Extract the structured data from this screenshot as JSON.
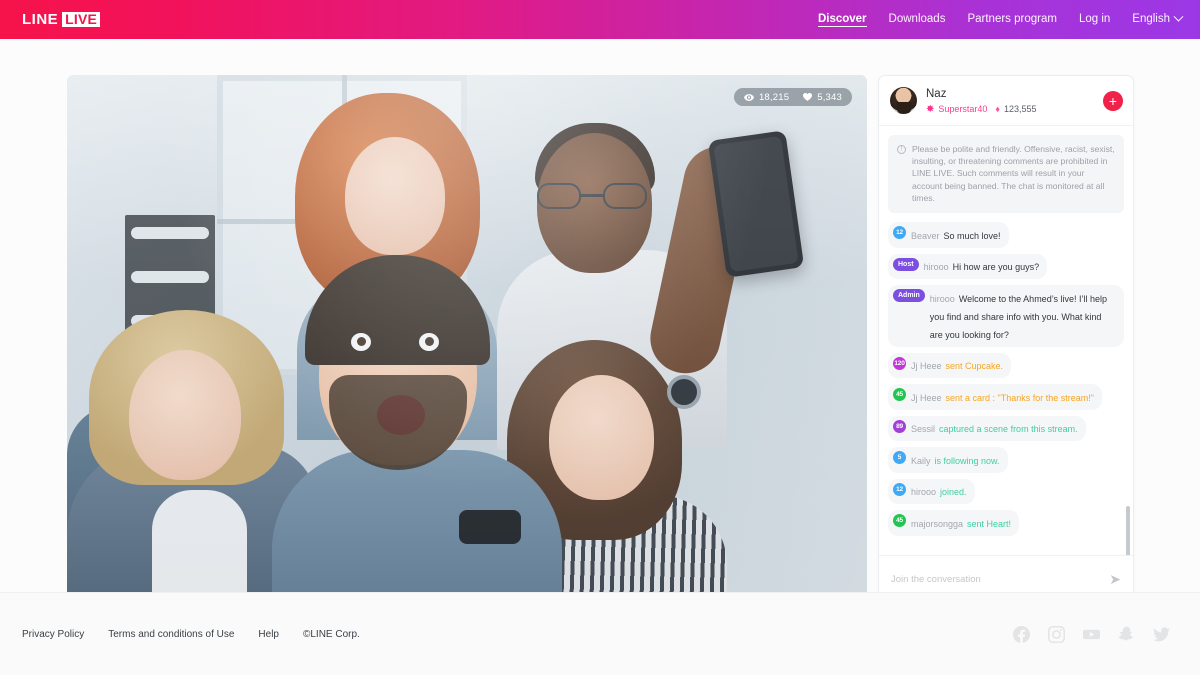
{
  "header": {
    "logo_line": "LINE",
    "logo_live": "LIVE",
    "nav": [
      {
        "label": "Discover",
        "active": true
      },
      {
        "label": "Downloads",
        "active": false
      },
      {
        "label": "Partners program",
        "active": false
      },
      {
        "label": "Log in",
        "active": false
      }
    ],
    "language": "English"
  },
  "video": {
    "viewers": "18,215",
    "likes": "5,343",
    "viewers_icon": "eye-icon",
    "likes_icon": "heart-icon"
  },
  "chat": {
    "host": {
      "name": "Naz",
      "badge_label": "Superstar40",
      "badge_icon": "star-icon",
      "gem_count": "123,555",
      "gem_icon": "gem-icon",
      "follow_label": "+"
    },
    "notice": "Please be polite and friendly. Offensive, racist, sexist, insulting, or threatening comments are prohibited in LINE LIVE. Such comments will result in your account being banned. The chat is monitored at all times.",
    "messages": [
      {
        "badge": "12",
        "badge_type": "level",
        "badge_color": "#3fa9f5",
        "user": "Beaver",
        "text": "So much love!",
        "style": "normal"
      },
      {
        "badge": "Host",
        "badge_type": "tag",
        "badge_color": "#7b4fe0",
        "user": "hirooo",
        "text": "Hi how are you guys?",
        "style": "normal"
      },
      {
        "badge": "Admin",
        "badge_type": "tag",
        "badge_color": "#7b4fe0",
        "user": "hirooo",
        "text": "Welcome to the Ahmed’s live! I’ll help you find and share info with you. What kind are you looking for?",
        "style": "normal"
      },
      {
        "badge": "120",
        "badge_type": "level",
        "badge_color": "#c038d6",
        "user": "Jj Heee",
        "text": "sent Cupcake.",
        "style": "gift"
      },
      {
        "badge": "45",
        "badge_type": "level",
        "badge_color": "#23c552",
        "user": "Jj Heee",
        "text": "sent a card : \"Thanks for the stream!\"",
        "style": "gift"
      },
      {
        "badge": "89",
        "badge_type": "level",
        "badge_color": "#a13fd6",
        "user": "Sessil",
        "text": "captured a scene from this stream.",
        "style": "sys"
      },
      {
        "badge": "5",
        "badge_type": "level",
        "badge_color": "#3fa9f5",
        "user": "Kaily",
        "text": "is following now.",
        "style": "sys"
      },
      {
        "badge": "12",
        "badge_type": "level",
        "badge_color": "#3fa9f5",
        "user": "hirooo",
        "text": "joined.",
        "style": "sys"
      },
      {
        "badge": "45",
        "badge_type": "level",
        "badge_color": "#23c552",
        "user": "majorsongga",
        "text": "sent Heart!",
        "style": "sys"
      }
    ],
    "input_placeholder": "Join the conversation",
    "send_icon": "send-icon"
  },
  "footer": {
    "links": [
      "Privacy Policy",
      "Terms and conditions of Use",
      "Help"
    ],
    "copyright": "©LINE Corp.",
    "social": [
      "facebook-icon",
      "instagram-icon",
      "youtube-icon",
      "snapchat-icon",
      "twitter-icon"
    ]
  },
  "colors": {
    "brand_start": "#f6134b",
    "brand_end": "#9b38e6",
    "accent_red": "#f02249",
    "pink": "#ff3b8e",
    "gift_orange": "#f5a623",
    "system_green": "#3fcfa0"
  }
}
